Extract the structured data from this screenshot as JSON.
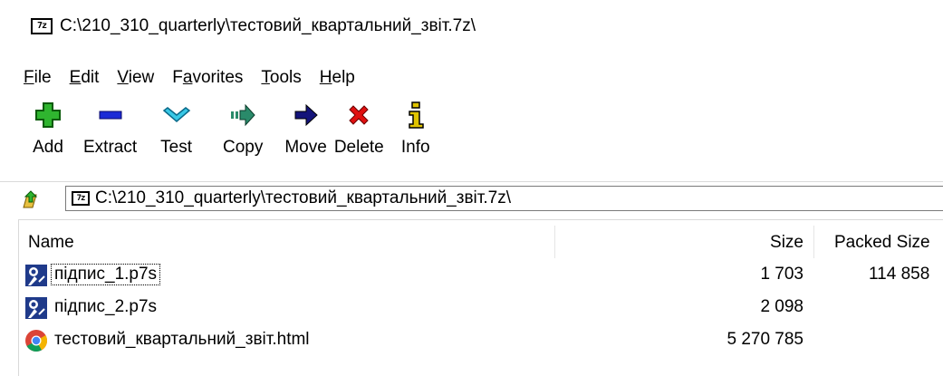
{
  "window": {
    "title": "C:\\210_310_quarterly\\тестовий_квартальний_звіт.7z\\",
    "icon_text": "7z"
  },
  "menu": [
    {
      "label": "File",
      "mnemonic": "F"
    },
    {
      "label": "Edit",
      "mnemonic": "E"
    },
    {
      "label": "View",
      "mnemonic": "V"
    },
    {
      "label": "Favorites",
      "mnemonic": "a"
    },
    {
      "label": "Tools",
      "mnemonic": "T"
    },
    {
      "label": "Help",
      "mnemonic": "H"
    }
  ],
  "toolbar": {
    "add": "Add",
    "extract": "Extract",
    "test": "Test",
    "copy": "Copy",
    "move": "Move",
    "delete": "Delete",
    "info": "Info"
  },
  "address": {
    "path": "C:\\210_310_quarterly\\тестовий_квартальний_звіт.7z\\",
    "icon_text": "7z"
  },
  "columns": {
    "name": "Name",
    "size": "Size",
    "packed_size": "Packed Size"
  },
  "files": [
    {
      "name": "підпис_1.p7s",
      "size": "1 703",
      "packed_size": "114 858",
      "icon": "signature-file-icon"
    },
    {
      "name": "підпис_2.p7s",
      "size": "2 098",
      "packed_size": "",
      "icon": "signature-file-icon"
    },
    {
      "name": "тестовий_квартальний_звіт.html",
      "size": "5 270 785",
      "packed_size": "",
      "icon": "chrome-html-file-icon"
    }
  ],
  "colors": {
    "add_icon": "#2fb52f",
    "extract_icon": "#1c2bd6",
    "test_icon": "#38c8e6",
    "copy_icon": "#2a8a6a",
    "move_icon": "#14147a",
    "delete_icon": "#e01010",
    "info_icon": "#e0c400"
  }
}
